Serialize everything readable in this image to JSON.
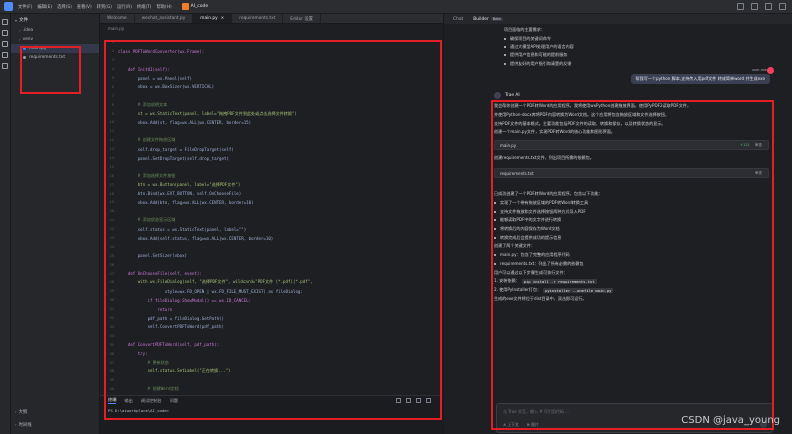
{
  "titlebar": {
    "menus": [
      "文件(F)",
      "编辑(E)",
      "选择(S)",
      "查看(V)",
      "转到(G)",
      "运行(R)",
      "终端(T)",
      "帮助(H)"
    ],
    "project": "AI_code"
  },
  "explorer": {
    "header": "文件",
    "tree": [
      {
        "label": ".idea",
        "type": "folder"
      },
      {
        "label": "venv",
        "type": "folder"
      },
      {
        "label": "main.py",
        "type": "file",
        "selected": true
      },
      {
        "label": "requirements.txt",
        "type": "file"
      }
    ],
    "footer1": "大纲",
    "footer2": "时间线"
  },
  "editor": {
    "tabs": [
      "Welcome",
      "wechat_assistant.py",
      "main.py",
      "requirements.txt",
      "Editor 设置"
    ],
    "breadcrumb": "main.py",
    "lines": [
      {
        "t": "",
        "k": ""
      },
      {
        "t": "class PDFToWordConverter(wx.Frame):",
        "k": "kw"
      },
      {
        "t": "",
        "k": ""
      },
      {
        "t": "    def InitUI(self):",
        "k": "kw"
      },
      {
        "t": "        panel = wx.Panel(self)",
        "k": ""
      },
      {
        "t": "        vbox = wx.BoxSizer(wx.VERTICAL)",
        "k": ""
      },
      {
        "t": "",
        "k": ""
      },
      {
        "t": "        # 添加说明文本",
        "k": "cm"
      },
      {
        "t": "        st = wx.StaticText(panel, label=\"拖拽PDF文件到此处或点击选择文件转换\")",
        "k": "str"
      },
      {
        "t": "        vbox.Add(st, flag=wx.ALL|wx.CENTER, border=15)",
        "k": ""
      },
      {
        "t": "",
        "k": ""
      },
      {
        "t": "        # 创建文件拖放区域",
        "k": "cm"
      },
      {
        "t": "        self.drop_target = FileDropTarget(self)",
        "k": ""
      },
      {
        "t": "        panel.SetDropTarget(self.drop_target)",
        "k": ""
      },
      {
        "t": "",
        "k": ""
      },
      {
        "t": "        # 添加选择文件按钮",
        "k": "cm"
      },
      {
        "t": "        btn = wx.Button(panel, label=\"选择PDF文件\")",
        "k": "str"
      },
      {
        "t": "        btn.Bind(wx.EVT_BUTTON, self.OnChooseFile)",
        "k": ""
      },
      {
        "t": "        vbox.Add(btn, flag=wx.ALL|wx.CENTER, border=10)",
        "k": ""
      },
      {
        "t": "",
        "k": ""
      },
      {
        "t": "        # 添加状态显示区域",
        "k": "cm"
      },
      {
        "t": "        self.status = wx.StaticText(panel, label=\"\")",
        "k": ""
      },
      {
        "t": "        vbox.Add(self.status, flag=wx.ALL|wx.CENTER, border=10)",
        "k": ""
      },
      {
        "t": "",
        "k": ""
      },
      {
        "t": "        panel.SetSizer(vbox)",
        "k": ""
      },
      {
        "t": "",
        "k": ""
      },
      {
        "t": "    def OnChooseFile(self, event):",
        "k": "kw"
      },
      {
        "t": "        with wx.FileDialog(self, \"选择PDF文件\", wildcard=\"PDF文件 (*.pdf)|*.pdf\",",
        "k": "str"
      },
      {
        "t": "                   style=wx.FD_OPEN | wx.FD_FILE_MUST_EXIST) as fileDialog:",
        "k": ""
      },
      {
        "t": "            if fileDialog.ShowModal() == wx.ID_CANCEL:",
        "k": "kw"
      },
      {
        "t": "                return",
        "k": "kw"
      },
      {
        "t": "            pdf_path = fileDialog.GetPath()",
        "k": ""
      },
      {
        "t": "            self.ConvertPDFToWord(pdf_path)",
        "k": ""
      },
      {
        "t": "",
        "k": ""
      },
      {
        "t": "    def ConvertPDFToWord(self, pdf_path):",
        "k": "kw"
      },
      {
        "t": "        try:",
        "k": "kw"
      },
      {
        "t": "            # 更新状态",
        "k": "cm"
      },
      {
        "t": "            self.status.SetLabel(\"正在转换...\")",
        "k": "str"
      },
      {
        "t": "",
        "k": ""
      },
      {
        "t": "            # 创建Word文档",
        "k": "cm"
      },
      {
        "t": "            doc = Document()",
        "k": ""
      }
    ]
  },
  "terminal": {
    "tabs": [
      "终端",
      "输出",
      "调试控制台",
      "问题"
    ],
    "line": "PS D:\\aiworkplace\\AI_code>"
  },
  "chat": {
    "tabs": [
      "Chat",
      "Builder"
    ],
    "beta": "Beta",
    "intro_lines": [
      {
        "t": "项目面临的主要需求：",
        "b": false
      },
      {
        "t": "确保项目的关键词命令",
        "b": true
      },
      {
        "t": "通过大模型API处理用户的语言内容",
        "b": true
      },
      {
        "t": "提供用户信息和可能的提前服务",
        "b": true
      },
      {
        "t": "提供友好的用户指引和清楚的反馈",
        "b": true
      }
    ],
    "user_name": "user-mary",
    "user_message": "帮我写一个python 脚本,支持传入用pdf文件 转成简单word 并生成exe",
    "ai_name": "Trae AI",
    "ai_lines_1": [
      {
        "t": "我会帮你创建一个PDF转Word的应用程序。我将使用wxPython创建拖放界面，使用PyPDF2读取PDF文件，",
        "b": false
      },
      {
        "t": "并使用Python-docx库将PDF内容转换为Word文档。这个应用将包含拖放区域和文件选择按钮，",
        "b": false
      },
      {
        "t": "支持PDF文件的基本格式。主要功能包括PDF文件的读取、转换和保存，以及转换状态的显示。",
        "b": false
      },
      {
        "t": "创建一个main.py文件，实现PDF转Word的核心功能和图形界面。",
        "b": false
      }
    ],
    "card1": "main.py",
    "card_add": "+121",
    "card_action": "审查",
    "ai_line_2": "创建requirements.txt文件，列出项目所需的依赖包。",
    "card2": "requirements.txt",
    "ai_lines_3": [
      {
        "t": "已成功创建了一个PDF转Word的应用程序，包含以下功能：",
        "b": false
      },
      {
        "t": "实现了一个带有拖放区域的PDF转Word转换工具",
        "b": true
      },
      {
        "t": "支持文件拖放和文件选择按钮两种方式导入PDF",
        "b": true
      },
      {
        "t": "能够读取PDF中的文字并进行转换",
        "b": true
      },
      {
        "t": "将转换后的内容保存为Word文档",
        "b": true
      },
      {
        "t": "转换完成后会提供成功的提示信息",
        "b": true
      },
      {
        "t": "创建了两个关键文件：",
        "b": false
      },
      {
        "t": "main.py：包含了完整的应用程序代码",
        "b": true
      },
      {
        "t": "requirements.txt：列出了所有必需的依赖包",
        "b": true
      },
      {
        "t": "用户可以通过以下步骤生成可执行文件：",
        "b": false
      }
    ],
    "step1_prefix": "1. 安装依赖：",
    "step1_cmd": "pip install -r requirements.txt",
    "step2_prefix": "2. 使用PyInstaller打包：",
    "step2_cmd": "pyinstaller --onefile main.py",
    "final_line": "生成的exe文件将位于dist目录中，双击即可运行。",
    "input_placeholder": "与 Trae 交互，输入 # 可引用代码 ...",
    "input_tools": [
      "# 上下文",
      "⊞ 图片"
    ]
  },
  "watermark": "CSDN @java_young"
}
